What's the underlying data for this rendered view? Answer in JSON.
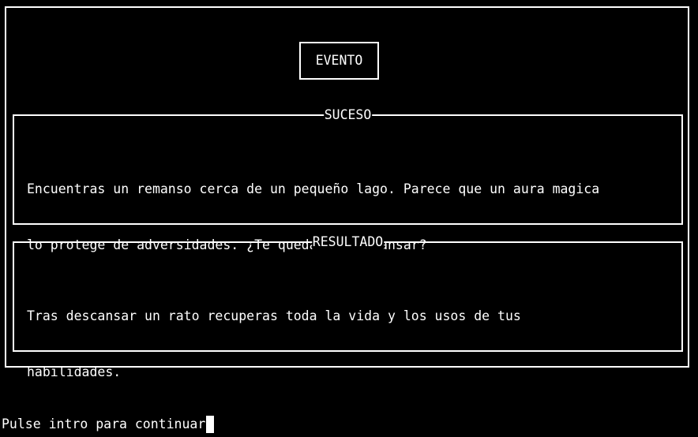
{
  "event": {
    "title": "EVENTO"
  },
  "suceso": {
    "label": "SUCESO",
    "lines": [
      "Encuentras un remanso cerca de un pequeño lago. Parece que un aura magica",
      "lo protege de adversidades. ¿Te quedas a descansar?"
    ]
  },
  "resultado": {
    "label": "RESULTADO",
    "lines": [
      "Tras descansar un rato recuperas toda la vida y los usos de tus",
      "habilidades."
    ]
  },
  "prompt": {
    "text": "Pulse intro para continuar"
  },
  "colors": {
    "background": "#000000",
    "foreground": "#ffffff"
  }
}
